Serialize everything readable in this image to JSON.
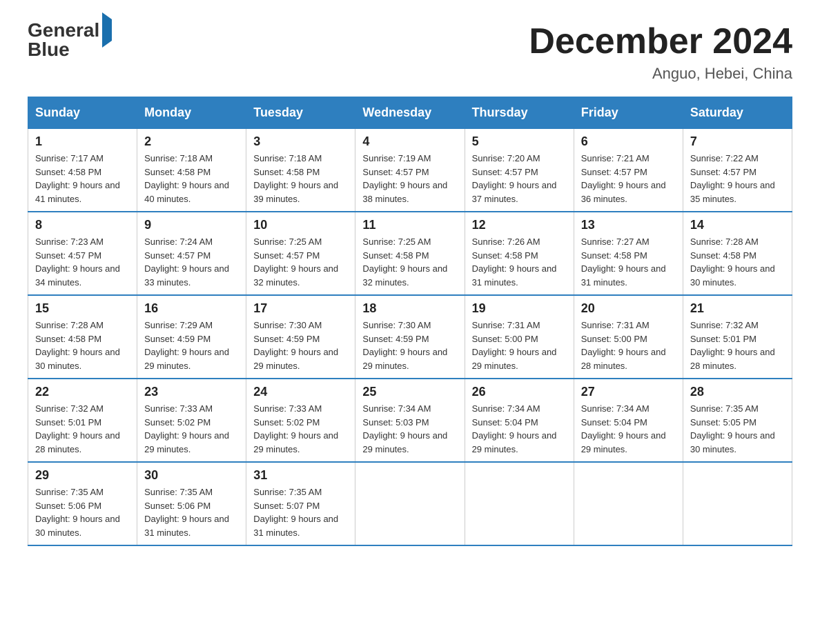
{
  "header": {
    "logo_text1": "General",
    "logo_text2": "Blue",
    "month_title": "December 2024",
    "location": "Anguo, Hebei, China"
  },
  "weekdays": [
    "Sunday",
    "Monday",
    "Tuesday",
    "Wednesday",
    "Thursday",
    "Friday",
    "Saturday"
  ],
  "weeks": [
    [
      {
        "day": "1",
        "sunrise": "7:17 AM",
        "sunset": "4:58 PM",
        "daylight": "9 hours and 41 minutes."
      },
      {
        "day": "2",
        "sunrise": "7:18 AM",
        "sunset": "4:58 PM",
        "daylight": "9 hours and 40 minutes."
      },
      {
        "day": "3",
        "sunrise": "7:18 AM",
        "sunset": "4:58 PM",
        "daylight": "9 hours and 39 minutes."
      },
      {
        "day": "4",
        "sunrise": "7:19 AM",
        "sunset": "4:57 PM",
        "daylight": "9 hours and 38 minutes."
      },
      {
        "day": "5",
        "sunrise": "7:20 AM",
        "sunset": "4:57 PM",
        "daylight": "9 hours and 37 minutes."
      },
      {
        "day": "6",
        "sunrise": "7:21 AM",
        "sunset": "4:57 PM",
        "daylight": "9 hours and 36 minutes."
      },
      {
        "day": "7",
        "sunrise": "7:22 AM",
        "sunset": "4:57 PM",
        "daylight": "9 hours and 35 minutes."
      }
    ],
    [
      {
        "day": "8",
        "sunrise": "7:23 AM",
        "sunset": "4:57 PM",
        "daylight": "9 hours and 34 minutes."
      },
      {
        "day": "9",
        "sunrise": "7:24 AM",
        "sunset": "4:57 PM",
        "daylight": "9 hours and 33 minutes."
      },
      {
        "day": "10",
        "sunrise": "7:25 AM",
        "sunset": "4:57 PM",
        "daylight": "9 hours and 32 minutes."
      },
      {
        "day": "11",
        "sunrise": "7:25 AM",
        "sunset": "4:58 PM",
        "daylight": "9 hours and 32 minutes."
      },
      {
        "day": "12",
        "sunrise": "7:26 AM",
        "sunset": "4:58 PM",
        "daylight": "9 hours and 31 minutes."
      },
      {
        "day": "13",
        "sunrise": "7:27 AM",
        "sunset": "4:58 PM",
        "daylight": "9 hours and 31 minutes."
      },
      {
        "day": "14",
        "sunrise": "7:28 AM",
        "sunset": "4:58 PM",
        "daylight": "9 hours and 30 minutes."
      }
    ],
    [
      {
        "day": "15",
        "sunrise": "7:28 AM",
        "sunset": "4:58 PM",
        "daylight": "9 hours and 30 minutes."
      },
      {
        "day": "16",
        "sunrise": "7:29 AM",
        "sunset": "4:59 PM",
        "daylight": "9 hours and 29 minutes."
      },
      {
        "day": "17",
        "sunrise": "7:30 AM",
        "sunset": "4:59 PM",
        "daylight": "9 hours and 29 minutes."
      },
      {
        "day": "18",
        "sunrise": "7:30 AM",
        "sunset": "4:59 PM",
        "daylight": "9 hours and 29 minutes."
      },
      {
        "day": "19",
        "sunrise": "7:31 AM",
        "sunset": "5:00 PM",
        "daylight": "9 hours and 29 minutes."
      },
      {
        "day": "20",
        "sunrise": "7:31 AM",
        "sunset": "5:00 PM",
        "daylight": "9 hours and 28 minutes."
      },
      {
        "day": "21",
        "sunrise": "7:32 AM",
        "sunset": "5:01 PM",
        "daylight": "9 hours and 28 minutes."
      }
    ],
    [
      {
        "day": "22",
        "sunrise": "7:32 AM",
        "sunset": "5:01 PM",
        "daylight": "9 hours and 28 minutes."
      },
      {
        "day": "23",
        "sunrise": "7:33 AM",
        "sunset": "5:02 PM",
        "daylight": "9 hours and 29 minutes."
      },
      {
        "day": "24",
        "sunrise": "7:33 AM",
        "sunset": "5:02 PM",
        "daylight": "9 hours and 29 minutes."
      },
      {
        "day": "25",
        "sunrise": "7:34 AM",
        "sunset": "5:03 PM",
        "daylight": "9 hours and 29 minutes."
      },
      {
        "day": "26",
        "sunrise": "7:34 AM",
        "sunset": "5:04 PM",
        "daylight": "9 hours and 29 minutes."
      },
      {
        "day": "27",
        "sunrise": "7:34 AM",
        "sunset": "5:04 PM",
        "daylight": "9 hours and 29 minutes."
      },
      {
        "day": "28",
        "sunrise": "7:35 AM",
        "sunset": "5:05 PM",
        "daylight": "9 hours and 30 minutes."
      }
    ],
    [
      {
        "day": "29",
        "sunrise": "7:35 AM",
        "sunset": "5:06 PM",
        "daylight": "9 hours and 30 minutes."
      },
      {
        "day": "30",
        "sunrise": "7:35 AM",
        "sunset": "5:06 PM",
        "daylight": "9 hours and 31 minutes."
      },
      {
        "day": "31",
        "sunrise": "7:35 AM",
        "sunset": "5:07 PM",
        "daylight": "9 hours and 31 minutes."
      },
      null,
      null,
      null,
      null
    ]
  ]
}
